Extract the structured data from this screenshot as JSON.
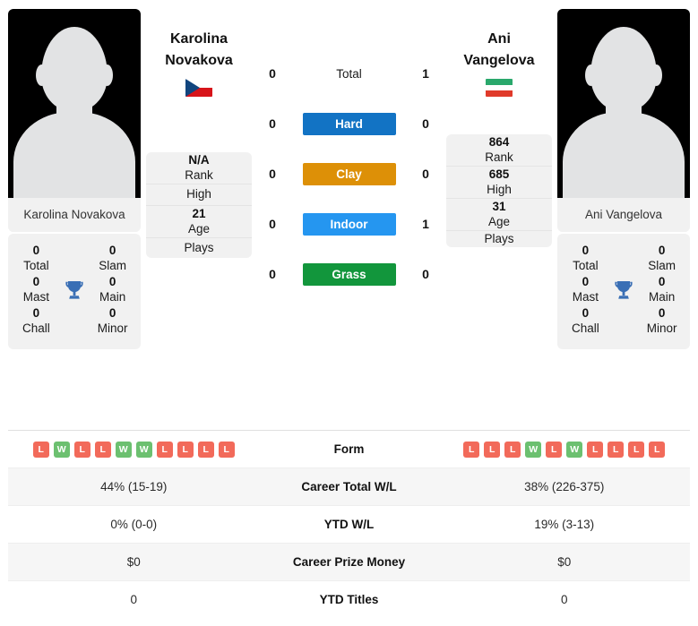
{
  "players": {
    "left": {
      "name_line1": "Karolina",
      "name_line2": "Novakova",
      "full_name": "Karolina Novakova",
      "flag": "czech-republic-flag",
      "photo_caption": "Karolina Novakova",
      "info": [
        {
          "value": "N/A",
          "label": "Rank"
        },
        {
          "value": "",
          "label": "High"
        },
        {
          "value": "21",
          "label": "Age"
        },
        {
          "value": "",
          "label": "Plays"
        }
      ],
      "titles": [
        {
          "value": "0",
          "label": "Total"
        },
        {
          "value": "0",
          "label": "Slam"
        },
        {
          "value": "0",
          "label": "Mast"
        },
        {
          "value": "0",
          "label": "Main"
        },
        {
          "value": "0",
          "label": "Chall"
        },
        {
          "value": "0",
          "label": "Minor"
        }
      ],
      "form": [
        "L",
        "W",
        "L",
        "L",
        "W",
        "W",
        "L",
        "L",
        "L",
        "L"
      ]
    },
    "right": {
      "name_line1": "Ani",
      "name_line2": "Vangelova",
      "full_name": "Ani Vangelova",
      "flag": "bulgaria-flag",
      "photo_caption": "Ani Vangelova",
      "info": [
        {
          "value": "864",
          "label": "Rank"
        },
        {
          "value": "685",
          "label": "High"
        },
        {
          "value": "31",
          "label": "Age"
        },
        {
          "value": "",
          "label": "Plays"
        }
      ],
      "titles": [
        {
          "value": "0",
          "label": "Total"
        },
        {
          "value": "0",
          "label": "Slam"
        },
        {
          "value": "0",
          "label": "Mast"
        },
        {
          "value": "0",
          "label": "Main"
        },
        {
          "value": "0",
          "label": "Chall"
        },
        {
          "value": "0",
          "label": "Minor"
        }
      ],
      "form": [
        "L",
        "L",
        "L",
        "W",
        "L",
        "W",
        "L",
        "L",
        "L",
        "L"
      ]
    }
  },
  "head_to_head": [
    {
      "label": "Total",
      "left": "0",
      "right": "1",
      "color": ""
    },
    {
      "label": "Hard",
      "left": "0",
      "right": "0",
      "color": "#1273c4"
    },
    {
      "label": "Clay",
      "left": "0",
      "right": "0",
      "color": "#dd9007"
    },
    {
      "label": "Indoor",
      "left": "0",
      "right": "1",
      "color": "#2596f0"
    },
    {
      "label": "Grass",
      "left": "0",
      "right": "0",
      "color": "#12963c"
    }
  ],
  "stats": [
    {
      "label": "Form",
      "left": "",
      "right": "",
      "type": "form"
    },
    {
      "label": "Career Total W/L",
      "left": "44% (15-19)",
      "right": "38% (226-375)",
      "type": "text"
    },
    {
      "label": "YTD W/L",
      "left": "0% (0-0)",
      "right": "19% (3-13)",
      "type": "text"
    },
    {
      "label": "Career Prize Money",
      "left": "$0",
      "right": "$0",
      "type": "text"
    },
    {
      "label": "YTD Titles",
      "left": "0",
      "right": "0",
      "type": "text"
    }
  ],
  "icons": {
    "trophy": "trophy-icon"
  },
  "colors": {
    "hard": "#1273c4",
    "clay": "#dd9007",
    "indoor": "#2596f0",
    "grass": "#12963c",
    "win": "#6cc070",
    "loss": "#f26a5a",
    "trophy": "#3a6fb5"
  }
}
